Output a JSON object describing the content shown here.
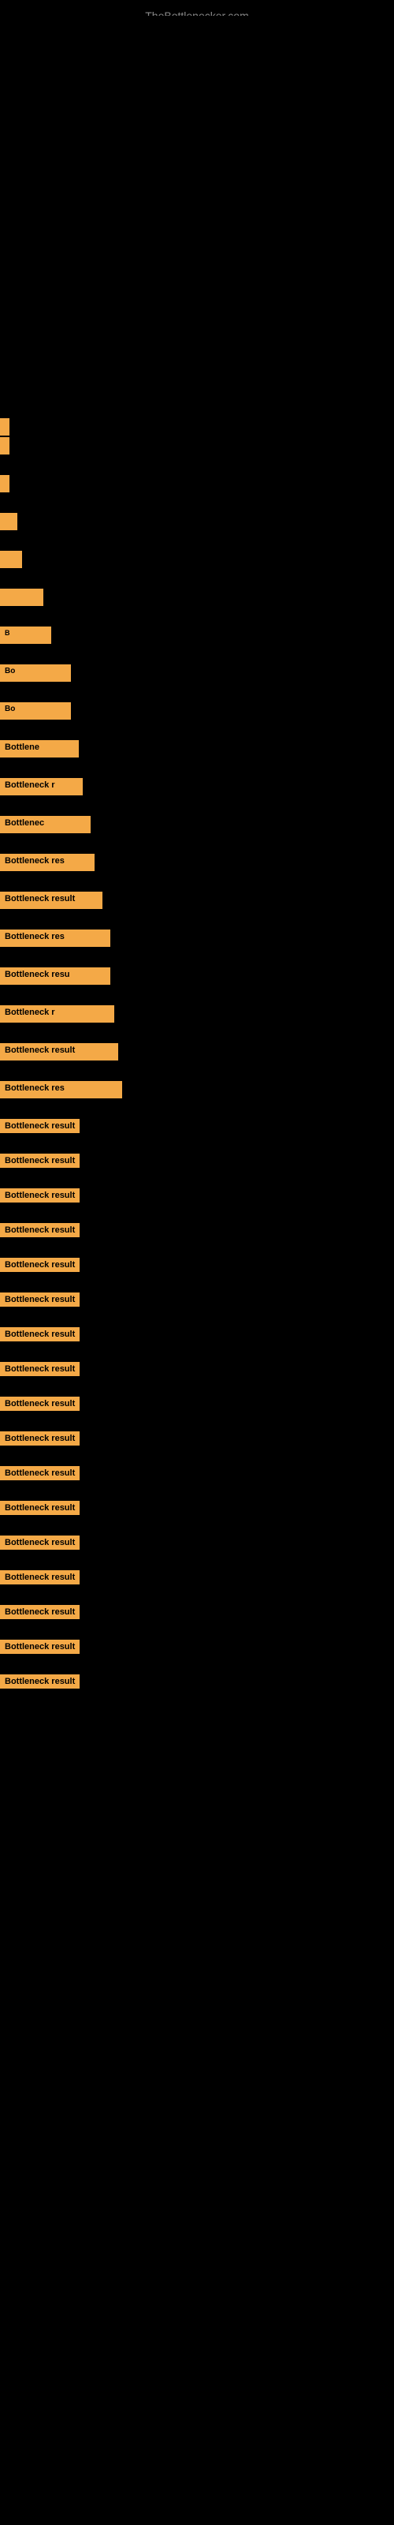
{
  "site": {
    "title": "TheBottlenecker.com"
  },
  "results": {
    "label": "Bottleneck result",
    "items": [
      {
        "id": 1,
        "text": ""
      },
      {
        "id": 2,
        "text": ""
      },
      {
        "id": 3,
        "text": ""
      },
      {
        "id": 4,
        "text": ""
      },
      {
        "id": 5,
        "text": ""
      },
      {
        "id": 6,
        "text": ""
      },
      {
        "id": 7,
        "text": "B"
      },
      {
        "id": 8,
        "text": "Bo"
      },
      {
        "id": 9,
        "text": "Bo"
      },
      {
        "id": 10,
        "text": "Bottlene"
      },
      {
        "id": 11,
        "text": "Bottleneck r"
      },
      {
        "id": 12,
        "text": "Bottlenec"
      },
      {
        "id": 13,
        "text": "Bottleneck res"
      },
      {
        "id": 14,
        "text": "Bottleneck result"
      },
      {
        "id": 15,
        "text": "Bottleneck res"
      },
      {
        "id": 16,
        "text": "Bottleneck resu"
      },
      {
        "id": 17,
        "text": "Bottleneck r"
      },
      {
        "id": 18,
        "text": "Bottleneck result"
      },
      {
        "id": 19,
        "text": "Bottleneck res"
      },
      {
        "id": 20,
        "text": "Bottleneck result"
      },
      {
        "id": 21,
        "text": "Bottleneck result"
      },
      {
        "id": 22,
        "text": "Bottleneck result"
      },
      {
        "id": 23,
        "text": "Bottleneck result"
      },
      {
        "id": 24,
        "text": "Bottleneck result"
      },
      {
        "id": 25,
        "text": "Bottleneck result"
      },
      {
        "id": 26,
        "text": "Bottleneck result"
      },
      {
        "id": 27,
        "text": "Bottleneck result"
      },
      {
        "id": 28,
        "text": "Bottleneck result"
      },
      {
        "id": 29,
        "text": "Bottleneck result"
      },
      {
        "id": 30,
        "text": "Bottleneck result"
      },
      {
        "id": 31,
        "text": "Bottleneck result"
      },
      {
        "id": 32,
        "text": "Bottleneck result"
      },
      {
        "id": 33,
        "text": "Bottleneck result"
      },
      {
        "id": 34,
        "text": "Bottleneck result"
      },
      {
        "id": 35,
        "text": "Bottleneck result"
      },
      {
        "id": 36,
        "text": "Bottleneck result"
      }
    ]
  }
}
